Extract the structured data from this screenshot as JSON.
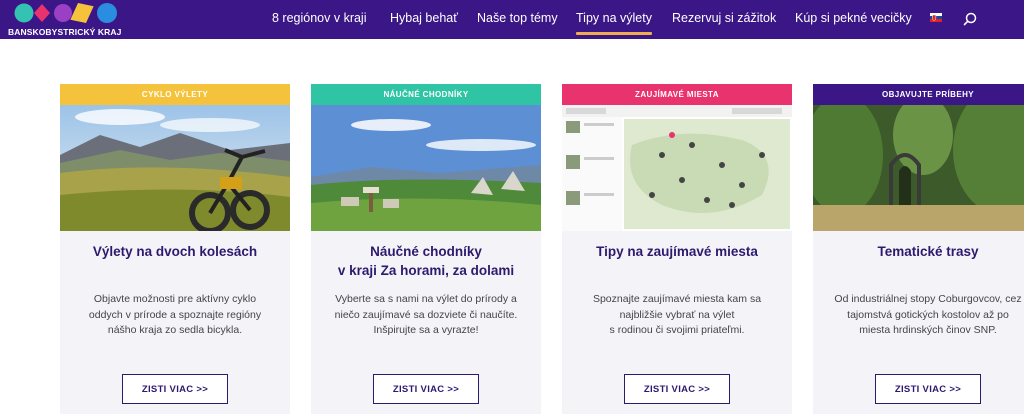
{
  "header": {
    "logo_text": "BANSKOBYSTRICKÝ KRAJ",
    "nav": [
      {
        "label": "8 regiónov v kraji",
        "active": false
      },
      {
        "label": "Hybaj behať",
        "active": false
      },
      {
        "label": "Naše top témy",
        "active": false
      },
      {
        "label": "Tipy na výlety",
        "active": true
      },
      {
        "label": "Rezervuj si zážitok",
        "active": false
      },
      {
        "label": "Kúp si pekné vecičky",
        "active": false
      }
    ],
    "language_flag": "slovak-flag-icon",
    "search_icon": "search-icon"
  },
  "cards": [
    {
      "label": "CYKLO VÝLETY",
      "label_color": "#f5c33b",
      "image": "mountain-bike-meadow-photo",
      "title": "Výlety na dvoch kolesách",
      "text": "Objavte možnosti pre aktívny cyklo\noddych v prírode a spoznajte regióny\nnášho kraja zo sedla bicykla.",
      "button": "ZISTI VIAC >>"
    },
    {
      "label": "NÁUČNÉ CHODNÍKY",
      "label_color": "#2ec4a4",
      "image": "educational-trail-landscape-photo",
      "title": "Náučné chodníky\nv kraji Za horami, za dolami",
      "text": "Vyberte sa s nami na výlet do prírody a\nniečo zaujímavé sa dozviete či naučíte.\nInšpirujte sa a vyrazte!",
      "button": "ZISTI VIAC >>"
    },
    {
      "label": "ZAUJÍMAVÉ MIESTA",
      "label_color": "#e8336e",
      "image": "interesting-places-map-screenshot",
      "title": "Tipy na zaujímavé miesta",
      "text": "Spoznajte zaujímavé miesta kam sa\nnajbližšie vybrať na výlet\ns rodinou či svojimi priateľmi.",
      "button": "ZISTI VIAC >>"
    },
    {
      "label": "OBJAVUJTE PRÍBEHY",
      "label_color": "#3b1687",
      "image": "forest-gothic-gate-photo",
      "title": "Tematické trasy",
      "text": "Od industriálnej stopy Coburgovcov, cez\ntajomstvá gotických kostolov až po\nmiesta hrdinských činov SNP.",
      "button": "ZISTI VIAC >>"
    }
  ]
}
